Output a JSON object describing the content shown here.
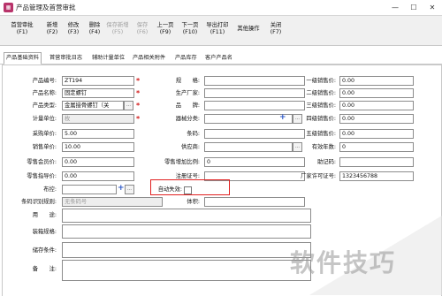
{
  "window": {
    "title": "产品管理及首营审批",
    "icon": "app-icon",
    "min": "—",
    "max": "☐",
    "close": "✕"
  },
  "toolbar": [
    {
      "l1": "首营审批",
      "l2": "(F1)",
      "state": "active"
    },
    {
      "l1": "新增",
      "l2": "(F2)",
      "state": "normal"
    },
    {
      "l1": "修改",
      "l2": "(F3)",
      "state": "normal"
    },
    {
      "l1": "删除",
      "l2": "(F4)",
      "state": "normal"
    },
    {
      "l1": "保存新增",
      "l2": "(F5)",
      "state": "disabled"
    },
    {
      "l1": "保存",
      "l2": "(F6)",
      "state": "disabled"
    },
    {
      "l1": "上一页",
      "l2": "(F9)",
      "state": "normal"
    },
    {
      "l1": "下一页",
      "l2": "(F10)",
      "state": "normal"
    },
    {
      "l1": "导出打印",
      "l2": "(F11)",
      "state": "normal"
    },
    {
      "l1": "其他操作",
      "l2": "",
      "state": "normal"
    },
    {
      "l1": "关闭",
      "l2": "(F7)",
      "state": "normal"
    }
  ],
  "tabs": [
    "产品基础资料",
    "首营审批日志",
    "辅助计量单位",
    "产品相关附件",
    "产品库存",
    "客户产品名"
  ],
  "form": {
    "product_code": {
      "label": "产品编号:",
      "value": "ZT194"
    },
    "product_name": {
      "label": "产品名称:",
      "value": "固定螺钉"
    },
    "product_type": {
      "label": "产品类型:",
      "value": "金属接骨螺钉（关",
      "icon": "ellipsis-icon"
    },
    "unit": {
      "label": "计量单位:",
      "value": "枚"
    },
    "purchase_price": {
      "label": "采购单价:",
      "value": "5.00"
    },
    "sale_price": {
      "label": "销售单价:",
      "value": "10.00"
    },
    "retail_member_price": {
      "label": "零售会员价:",
      "value": "0.00"
    },
    "retail_price": {
      "label": "零售指导价:",
      "value": "0.00"
    },
    "layout_position": {
      "label": "布控:",
      "value": ""
    },
    "dosage_form": {
      "label": "条码识别规则:",
      "value": "无条码号"
    },
    "usage": {
      "label": "用　　途:",
      "value": ""
    },
    "packing": {
      "label": "装箱规格:",
      "value": ""
    },
    "storage": {
      "label": "储存条件:",
      "value": ""
    },
    "remarks": {
      "label": "备　　注:",
      "value": ""
    },
    "spec": {
      "label": "规　　格:",
      "value": ""
    },
    "manufacturer": {
      "label": "生产厂家:",
      "value": ""
    },
    "brand": {
      "label": "品　　牌:",
      "value": ""
    },
    "device_category": {
      "label": "器械分类:",
      "value": ""
    },
    "barcode": {
      "label": "条码:",
      "value": ""
    },
    "supplier": {
      "label": "供应商:",
      "value": ""
    },
    "retail_markup_ratio": {
      "label": "零售增加比例:",
      "value": "0"
    },
    "registration_no": {
      "label": "注册证号:",
      "value": ""
    },
    "auto_expire": {
      "label": "自动失效:",
      "checked": false
    },
    "volume": {
      "label": "体积:",
      "value": ""
    },
    "price_l1": {
      "label": "一级销售价:",
      "value": "0.00"
    },
    "price_l2": {
      "label": "二级销售价:",
      "value": "0.00"
    },
    "price_l3": {
      "label": "三级销售价:",
      "value": "0.00"
    },
    "price_l4": {
      "label": "四级销售价:",
      "value": "0.00"
    },
    "price_l5": {
      "label": "五级销售价:",
      "value": "0.00"
    },
    "valid_years": {
      "label": "有效年数:",
      "value": "0"
    },
    "mnemonic": {
      "label": "助记码:",
      "value": ""
    },
    "factory_license": {
      "label": "厂家许可证号:",
      "value": "1323456788"
    }
  },
  "watermark": "软件技巧",
  "colors": {
    "accent": "#1c4fa0",
    "required": "#d21b1b",
    "highlight": "#e02020",
    "disabled": "#eeeeee"
  }
}
